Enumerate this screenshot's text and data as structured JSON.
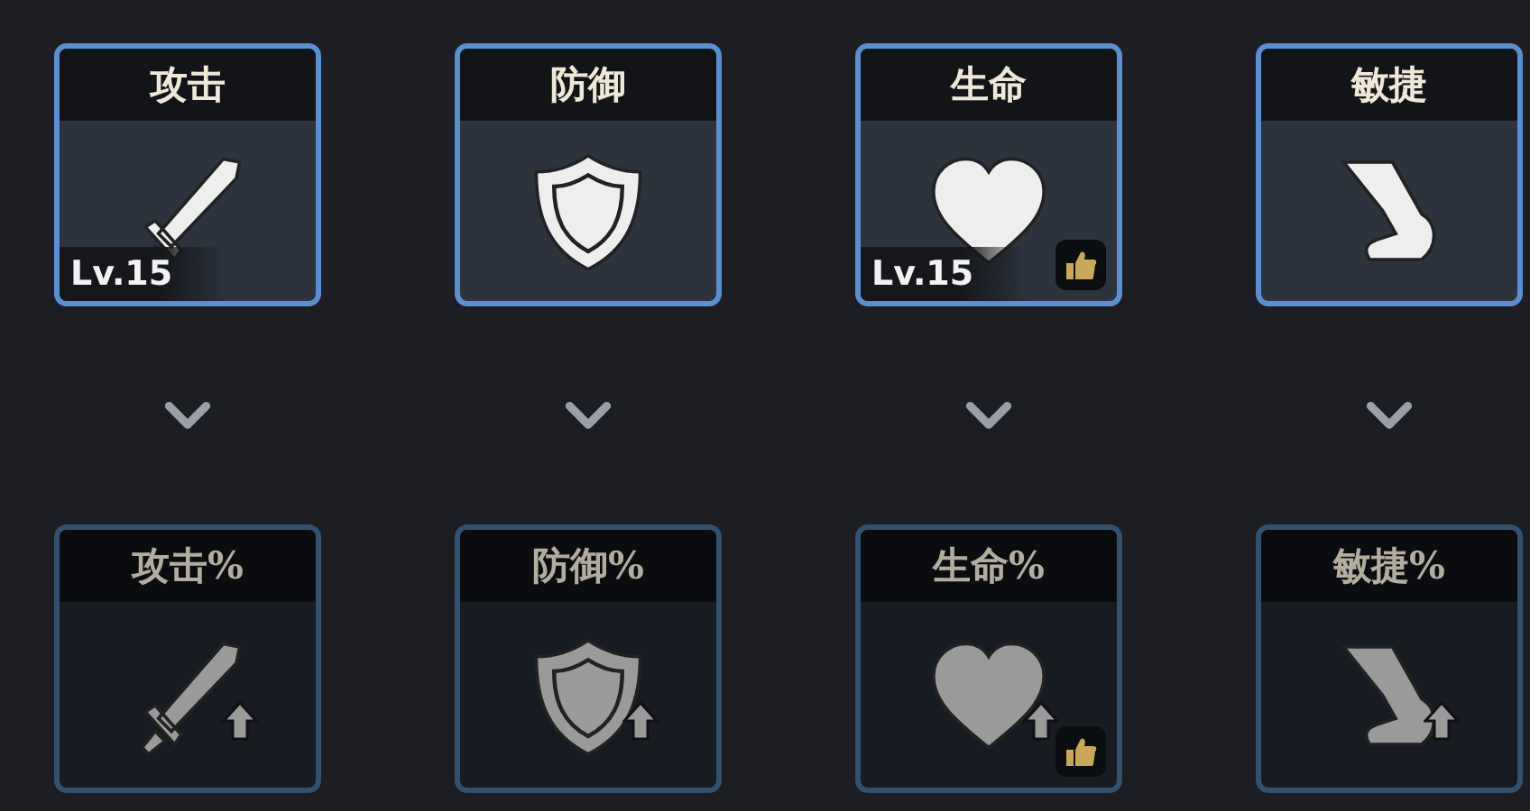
{
  "columns": [
    {
      "top": {
        "label": "攻击",
        "unlocked": true,
        "boost": false,
        "level": "Lv.15",
        "recommended": false
      },
      "bottom": {
        "label": "攻击%",
        "unlocked": false,
        "boost": true,
        "recommended": false
      }
    },
    {
      "top": {
        "label": "防御",
        "unlocked": true,
        "boost": false,
        "recommended": false
      },
      "bottom": {
        "label": "防御%",
        "unlocked": false,
        "boost": true,
        "recommended": false
      }
    },
    {
      "top": {
        "label": "生命",
        "unlocked": true,
        "boost": false,
        "level": "Lv.15",
        "recommended": true
      },
      "bottom": {
        "label": "生命%",
        "unlocked": false,
        "boost": true,
        "recommended": true
      }
    },
    {
      "top": {
        "label": "敏捷",
        "unlocked": true,
        "boost": false,
        "recommended": false
      },
      "bottom": {
        "label": "敏捷%",
        "unlocked": false,
        "boost": true,
        "recommended": false
      }
    }
  ]
}
